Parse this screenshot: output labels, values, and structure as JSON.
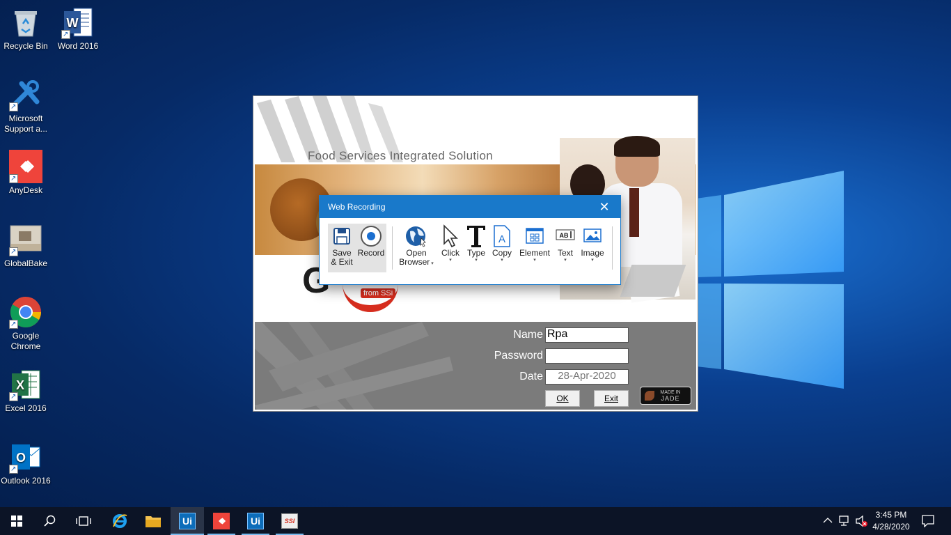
{
  "desktop": {
    "icons": [
      {
        "label": "Recycle Bin",
        "icon": "recycle-bin-icon"
      },
      {
        "label": "Word 2016",
        "icon": "word-icon"
      },
      {
        "label": "Microsoft Support a...",
        "icon": "tools-icon"
      },
      {
        "label": "AnyDesk",
        "icon": "anydesk-icon"
      },
      {
        "label": "GlobalBake",
        "icon": "globalbake-icon"
      },
      {
        "label": "Google Chrome",
        "icon": "chrome-icon"
      },
      {
        "label": "Excel 2016",
        "icon": "excel-icon"
      },
      {
        "label": "Outlook 2016",
        "icon": "outlook-icon"
      }
    ]
  },
  "splash": {
    "tagline": "Food Services Integrated Solution",
    "brand_initial": "G",
    "from_label": "from SSi",
    "login": {
      "name_label": "Name",
      "name_value": "Rpa",
      "password_label": "Password",
      "password_value": "",
      "date_label": "Date",
      "date_value": "28-Apr-2020",
      "ok_label": "OK",
      "exit_label": "Exit",
      "badge_line1": "MADE IN",
      "badge_line2": "JADE"
    }
  },
  "web_recording": {
    "title": "Web Recording",
    "close_glyph": "✕",
    "tools": [
      {
        "label": "Save",
        "label2": "& Exit",
        "icon": "save-icon"
      },
      {
        "label": "Record",
        "label2": "",
        "icon": "record-icon"
      },
      {
        "label": "Open",
        "label2": "Browser",
        "icon": "globe-icon"
      },
      {
        "label": "Click",
        "label2": "",
        "icon": "cursor-icon"
      },
      {
        "label": "Type",
        "label2": "",
        "icon": "type-icon"
      },
      {
        "label": "Copy",
        "label2": "",
        "icon": "copy-icon"
      },
      {
        "label": "Element",
        "label2": "",
        "icon": "element-icon"
      },
      {
        "label": "Text",
        "label2": "",
        "icon": "text-icon"
      },
      {
        "label": "Image",
        "label2": "",
        "icon": "image-icon"
      }
    ]
  },
  "taskbar": {
    "time": "3:45 PM",
    "date": "4/28/2020",
    "apps": [
      "start-icon",
      "search-icon",
      "task-view-icon",
      "ie-icon",
      "file-explorer-icon",
      "uipath-icon",
      "anydesk-icon",
      "uipath-icon",
      "ssi-icon"
    ],
    "uipath_label": "Ui",
    "ssi_label": "SSI"
  }
}
